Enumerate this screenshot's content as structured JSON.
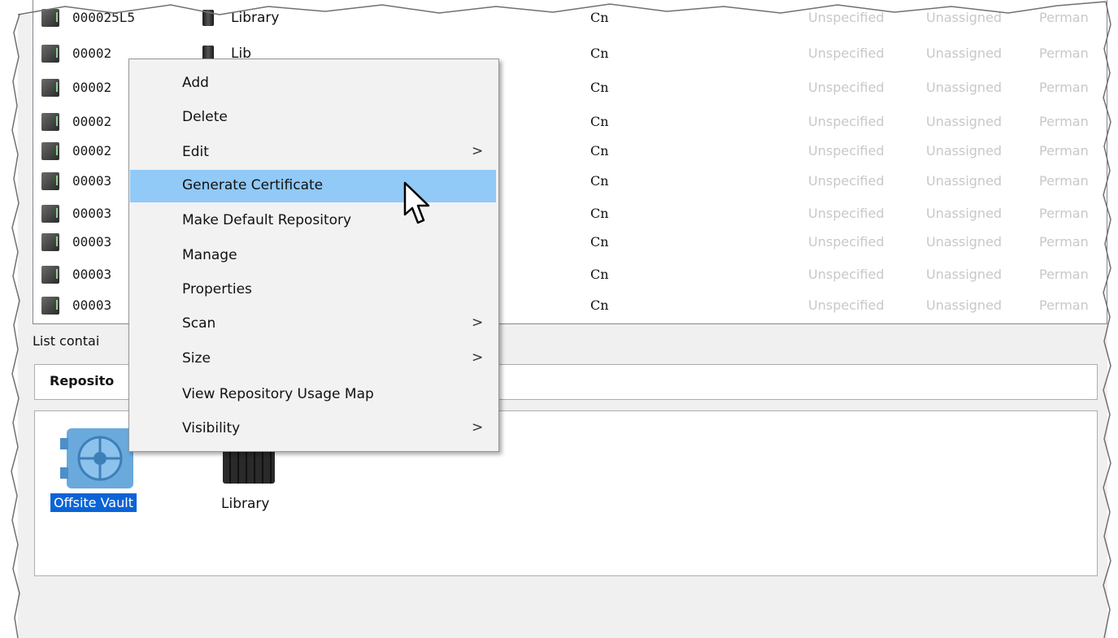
{
  "list": {
    "rows": [
      {
        "code": "000025L5",
        "repo": "Library",
        "cn": "Cn",
        "u1": "Unspecified",
        "u2": "Unassigned",
        "u3": "Perman"
      },
      {
        "code": "00002",
        "repo": "Lib",
        "cn": "Cn",
        "u1": "Unspecified",
        "u2": "Unassigned",
        "u3": "Perman"
      },
      {
        "code": "00002",
        "repo": "",
        "cn": "Cn",
        "u1": "Unspecified",
        "u2": "Unassigned",
        "u3": "Perman"
      },
      {
        "code": "00002",
        "repo": "",
        "cn": "Cn",
        "u1": "Unspecified",
        "u2": "Unassigned",
        "u3": "Perman"
      },
      {
        "code": "00002",
        "repo": "",
        "cn": "Cn",
        "u1": "Unspecified",
        "u2": "Unassigned",
        "u3": "Perman"
      },
      {
        "code": "00003",
        "repo": "",
        "cn": "Cn",
        "u1": "Unspecified",
        "u2": "Unassigned",
        "u3": "Perman"
      },
      {
        "code": "00003",
        "repo": "",
        "cn": "Cn",
        "u1": "Unspecified",
        "u2": "Unassigned",
        "u3": "Perman"
      },
      {
        "code": "00003",
        "repo": "",
        "cn": "Cn",
        "u1": "Unspecified",
        "u2": "Unassigned",
        "u3": "Perman"
      },
      {
        "code": "00003",
        "repo": "",
        "cn": "Cn",
        "u1": "Unspecified",
        "u2": "Unassigned",
        "u3": "Perman"
      },
      {
        "code": "00003",
        "repo": "",
        "cn": "Cn",
        "u1": "Unspecified",
        "u2": "Unassigned",
        "u3": "Perman"
      }
    ],
    "status": "List contai"
  },
  "repositories": {
    "tab_label": "Reposito",
    "items": [
      {
        "label": "Offsite Vault",
        "icon": "vault-icon"
      },
      {
        "label": "Library",
        "icon": "tape-library-icon"
      }
    ]
  },
  "context_menu": {
    "items": [
      {
        "label": "Add",
        "submenu": false
      },
      {
        "label": "Delete",
        "submenu": false
      },
      {
        "label": "Edit",
        "submenu": true
      },
      {
        "label": "Generate Certificate",
        "submenu": false,
        "highlighted": true
      },
      {
        "label": "Make Default Repository",
        "submenu": false
      },
      {
        "label": "Manage",
        "submenu": false
      },
      {
        "label": "Properties",
        "submenu": false
      },
      {
        "label": "Scan",
        "submenu": true
      },
      {
        "label": "Size",
        "submenu": true
      },
      {
        "label": "View Repository Usage Map",
        "submenu": false
      },
      {
        "label": "Visibility",
        "submenu": true
      }
    ],
    "submenu_glyph": ">"
  },
  "colors": {
    "highlight": "#91c9f7",
    "selection": "#0a64d6",
    "muted_text": "#c8c8c8"
  }
}
